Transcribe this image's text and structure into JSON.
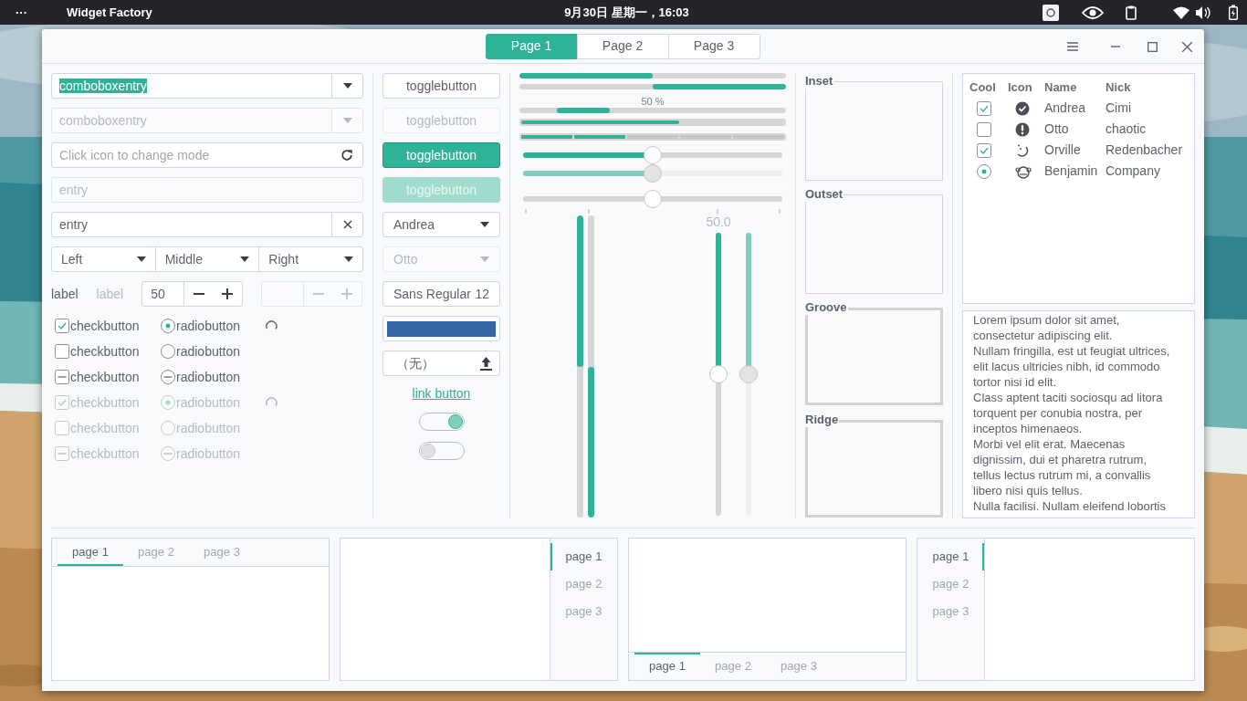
{
  "top_bar": {
    "menu": "···",
    "app_name": "Widget Factory",
    "clock": "9月30日 星期一，16:03"
  },
  "header": {
    "tabs": [
      {
        "label": "Page 1",
        "selected": true
      },
      {
        "label": "Page 2",
        "selected": false
      },
      {
        "label": "Page 3",
        "selected": false
      }
    ]
  },
  "combo_entries": [
    {
      "value": "comboboxentry",
      "text_selected": true,
      "disabled": false
    },
    {
      "value": "comboboxentry",
      "text_selected": false,
      "disabled": true
    }
  ],
  "mode_entry": {
    "placeholder": "Click icon to change mode"
  },
  "entries": [
    {
      "value": "entry",
      "disabled": true,
      "clearable": false
    },
    {
      "value": "entry",
      "disabled": false,
      "clearable": true
    }
  ],
  "linked_combos": [
    {
      "value": "Left"
    },
    {
      "value": "Middle"
    },
    {
      "value": "Right"
    }
  ],
  "labels": [
    {
      "text": "label",
      "disabled": false
    },
    {
      "text": "label",
      "disabled": true
    }
  ],
  "spin_buttons": [
    {
      "value": "50",
      "disabled": false
    },
    {
      "disabled": true
    }
  ],
  "check_rows": [
    {
      "check": {
        "label": "checkbutton",
        "checked": true,
        "inconsistent": false
      },
      "radio": {
        "label": "radiobutton",
        "checked": true,
        "inconsistent": false
      },
      "spinner": true,
      "disabled": false
    },
    {
      "check": {
        "label": "checkbutton",
        "checked": false,
        "inconsistent": false
      },
      "radio": {
        "label": "radiobutton",
        "checked": false,
        "inconsistent": false
      },
      "spinner": false,
      "disabled": false
    },
    {
      "check": {
        "label": "checkbutton",
        "checked": false,
        "inconsistent": true
      },
      "radio": {
        "label": "radiobutton",
        "checked": false,
        "inconsistent": true
      },
      "spinner": false,
      "disabled": false
    },
    {
      "check": {
        "label": "checkbutton",
        "checked": true,
        "inconsistent": false
      },
      "radio": {
        "label": "radiobutton",
        "checked": true,
        "inconsistent": false
      },
      "spinner": true,
      "disabled": true
    },
    {
      "check": {
        "label": "checkbutton",
        "checked": false,
        "inconsistent": false
      },
      "radio": {
        "label": "radiobutton",
        "checked": false,
        "inconsistent": false
      },
      "spinner": false,
      "disabled": true
    },
    {
      "check": {
        "label": "checkbutton",
        "checked": false,
        "inconsistent": true
      },
      "radio": {
        "label": "radiobutton",
        "checked": false,
        "inconsistent": true
      },
      "spinner": false,
      "disabled": true
    }
  ],
  "toggle_buttons": [
    {
      "label": "togglebutton",
      "active": false,
      "disabled": false
    },
    {
      "label": "togglebutton",
      "active": false,
      "disabled": true
    },
    {
      "label": "togglebutton",
      "active": true,
      "disabled": false
    },
    {
      "label": "togglebutton",
      "active": true,
      "disabled": true
    }
  ],
  "combos": [
    {
      "value": "Andrea",
      "disabled": false
    },
    {
      "value": "Otto",
      "disabled": true
    }
  ],
  "font_button": {
    "family": "Sans Regular",
    "size": "12"
  },
  "color_button": {
    "color": "#3465a4"
  },
  "file_button": {
    "label": "（无）"
  },
  "link_button": {
    "label": "link button"
  },
  "switches": [
    {
      "on": true
    },
    {
      "on": false
    }
  ],
  "progress_bars": [
    {
      "kind": "normal",
      "level": 0.5
    },
    {
      "kind": "inverted",
      "level": 0.5
    },
    {
      "kind": "pulse",
      "text": "50 %"
    }
  ],
  "level_bars": [
    {
      "kind": "continuous",
      "level": 0.6
    },
    {
      "kind": "discrete",
      "level": 0.4
    }
  ],
  "scales": [
    {
      "kind": "filled",
      "level": 0.5,
      "disabled": false
    },
    {
      "kind": "filled",
      "level": 0.5,
      "disabled": true
    },
    {
      "kind": "marked",
      "level": 0.5,
      "disabled": false
    }
  ],
  "vertical_progress": [
    {
      "level": 0.5,
      "inverted": false
    },
    {
      "level": 0.5,
      "inverted": true
    }
  ],
  "vertical_scales": [
    {
      "level": 0.5,
      "disabled": false,
      "value_label": "50.0"
    },
    {
      "level": 0.5,
      "disabled": true
    }
  ],
  "frames": [
    {
      "label": "Inset",
      "kind": "inset"
    },
    {
      "label": "Outset",
      "kind": "outset"
    },
    {
      "label": "Groove",
      "kind": "groove"
    },
    {
      "label": "Ridge",
      "kind": "ridge"
    }
  ],
  "tree": {
    "columns": [
      "Cool",
      "Icon",
      "Name",
      "Nick"
    ],
    "rows": [
      {
        "cool": {
          "kind": "check",
          "checked": true
        },
        "name": "Andrea",
        "nick": "Cimi"
      },
      {
        "cool": {
          "kind": "check",
          "checked": false
        },
        "name": "Otto",
        "nick": "chaotic"
      },
      {
        "cool": {
          "kind": "check",
          "checked": true
        },
        "name": "Orville",
        "nick": "Redenbacher"
      },
      {
        "cool": {
          "kind": "radio",
          "checked": true
        },
        "name": "Benjamin",
        "nick": "Company"
      }
    ]
  },
  "text_view": {
    "lines": [
      "Lorem ipsum dolor sit amet,",
      "consectetur adipiscing elit.",
      "Nullam fringilla, est ut feugiat ultrices,",
      "elit lacus ultricies nibh, id commodo",
      "tortor nisi id elit.",
      "Class aptent taciti sociosqu ad litora",
      "torquent per conubia nostra, per",
      "inceptos himenaeos.",
      "Morbi vel elit erat. Maecenas",
      "dignissim, dui et pharetra rutrum,",
      "tellus lectus rutrum mi, a convallis",
      "libero nisi quis tellus.",
      "Nulla facilisi. Nullam eleifend lobortis"
    ]
  },
  "notebooks": [
    {
      "kind": "top",
      "tabs": [
        {
          "label": "page 1",
          "selected": true
        },
        {
          "label": "page 2",
          "selected": false
        },
        {
          "label": "page 3",
          "selected": false
        }
      ]
    },
    {
      "kind": "right",
      "tabs": [
        {
          "label": "page 1",
          "selected": true
        },
        {
          "label": "page 2",
          "selected": false
        },
        {
          "label": "page 3",
          "selected": false
        }
      ]
    },
    {
      "kind": "bottom",
      "tabs": [
        {
          "label": "page 1",
          "selected": true
        },
        {
          "label": "page 2",
          "selected": false
        },
        {
          "label": "page 3",
          "selected": false
        }
      ]
    },
    {
      "kind": "left",
      "tabs": [
        {
          "label": "page 1",
          "selected": true
        },
        {
          "label": "page 2",
          "selected": false
        },
        {
          "label": "page 3",
          "selected": false
        }
      ]
    }
  ]
}
